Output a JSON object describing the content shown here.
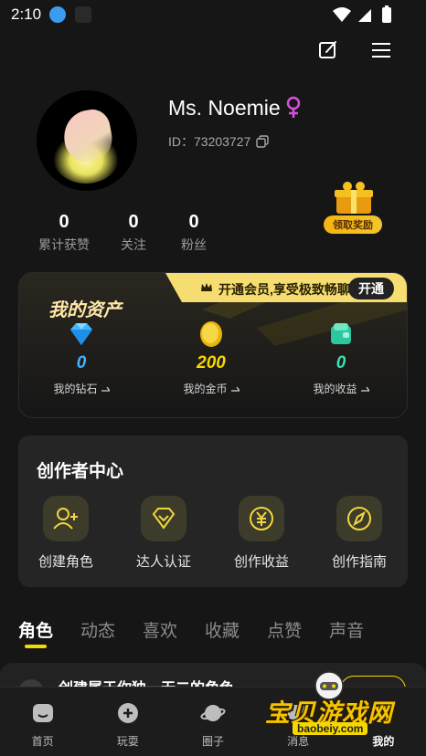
{
  "status_bar": {
    "time": "2:10"
  },
  "profile": {
    "username": "Ms. Noemie",
    "id_text": "ID：73203727"
  },
  "stats": [
    {
      "value": "0",
      "label": "累计获赞"
    },
    {
      "value": "0",
      "label": "关注"
    },
    {
      "value": "0",
      "label": "粉丝"
    }
  ],
  "reward": {
    "label": "领取奖励"
  },
  "assets": {
    "title": "我的资产",
    "vip_text": "开通会员,享受极致畅聊",
    "vip_button": "开通",
    "items": [
      {
        "value": "0",
        "label": "我的钻石",
        "color": "#3fb4ff"
      },
      {
        "value": "200",
        "label": "我的金币",
        "color": "#f5d800"
      },
      {
        "value": "0",
        "label": "我的收益",
        "color": "#39e0b4"
      }
    ]
  },
  "creator": {
    "title": "创作者中心",
    "items": [
      {
        "label": "创建角色",
        "icon": "add-user-icon"
      },
      {
        "label": "达人认证",
        "icon": "diamond-badge-icon"
      },
      {
        "label": "创作收益",
        "icon": "yen-icon"
      },
      {
        "label": "创作指南",
        "icon": "compass-icon"
      }
    ]
  },
  "tabs": [
    "角色",
    "动态",
    "喜欢",
    "收藏",
    "点赞",
    "声音"
  ],
  "promo": {
    "text": "创建属于你独一无二的角色"
  },
  "nav": [
    {
      "label": "首页",
      "icon": "home-icon"
    },
    {
      "label": "玩耍",
      "icon": "play-icon"
    },
    {
      "label": "圈子",
      "icon": "planet-icon"
    },
    {
      "label": "消息",
      "icon": "message-icon"
    },
    {
      "label": "我的",
      "icon": "profile-icon"
    }
  ],
  "watermark": {
    "title": "宝贝游戏网",
    "url": "baobeiy.com"
  },
  "colors": {
    "accent": "#f5d800",
    "background": "#161616",
    "card": "#252525",
    "gender": "#d94fe0"
  }
}
